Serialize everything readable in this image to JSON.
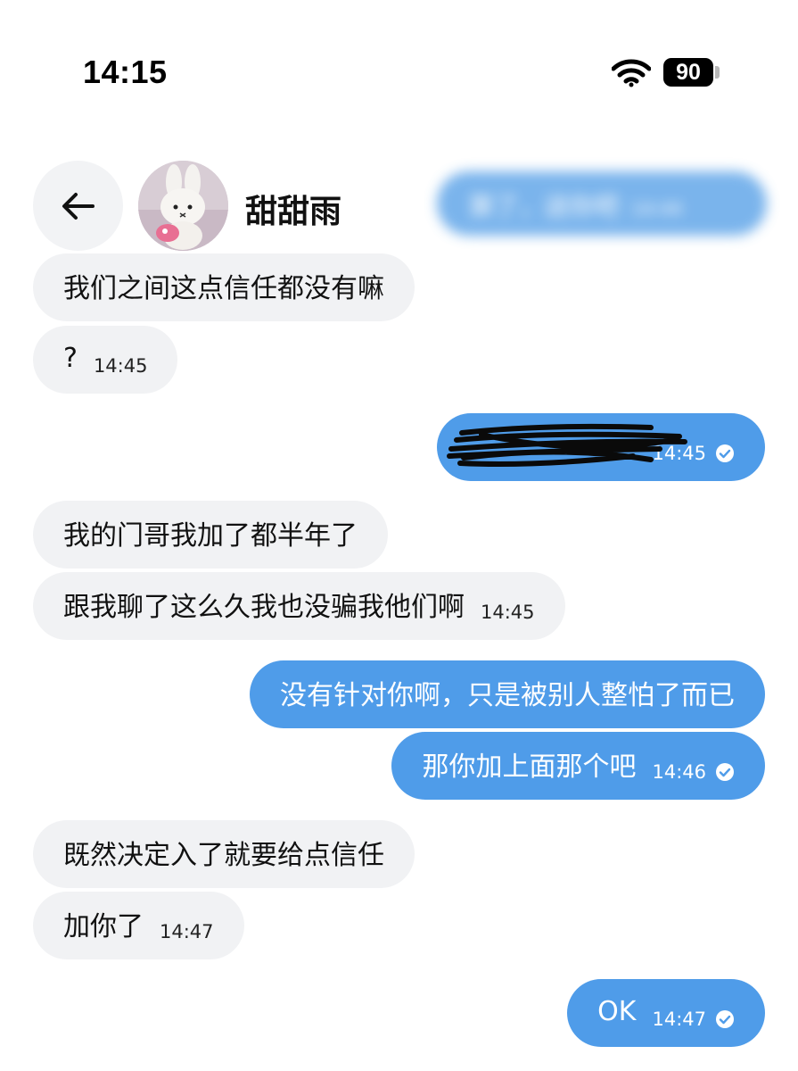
{
  "status_bar": {
    "time": "14:15",
    "battery": "90",
    "icons": [
      "wifi-icon",
      "battery-icon"
    ]
  },
  "header": {
    "contact_name": "甜甜雨",
    "back_icon": "arrow-left-icon",
    "faded_message": {
      "text": "算了，送你吧",
      "time": "14:44"
    }
  },
  "colors": {
    "incoming_bubble": "#f1f2f4",
    "outgoing_bubble": "#4f9ce9",
    "back_button_bg": "#f2f3f5"
  },
  "messages": [
    {
      "dir": "in",
      "text": "我们之间这点信任都没有嘛",
      "time": ""
    },
    {
      "dir": "in",
      "text": "?",
      "time": "14:45"
    },
    {
      "dir": "out",
      "text": "",
      "time": "14:45",
      "redacted": true,
      "read": true
    },
    {
      "dir": "in",
      "text": "我的门哥我加了都半年了",
      "time": ""
    },
    {
      "dir": "in",
      "text": "跟我聊了这么久我也没骗我他们啊",
      "time": "14:45"
    },
    {
      "dir": "out",
      "text": "没有针对你啊，只是被别人整怕了而已",
      "time": "",
      "read": false
    },
    {
      "dir": "out",
      "text": "那你加上面那个吧",
      "time": "14:46",
      "read": true
    },
    {
      "dir": "in",
      "text": "既然决定入了就要给点信任",
      "time": ""
    },
    {
      "dir": "in",
      "text": "加你了",
      "time": "14:47"
    },
    {
      "dir": "out",
      "text": "OK",
      "time": "14:47",
      "read": true
    }
  ]
}
